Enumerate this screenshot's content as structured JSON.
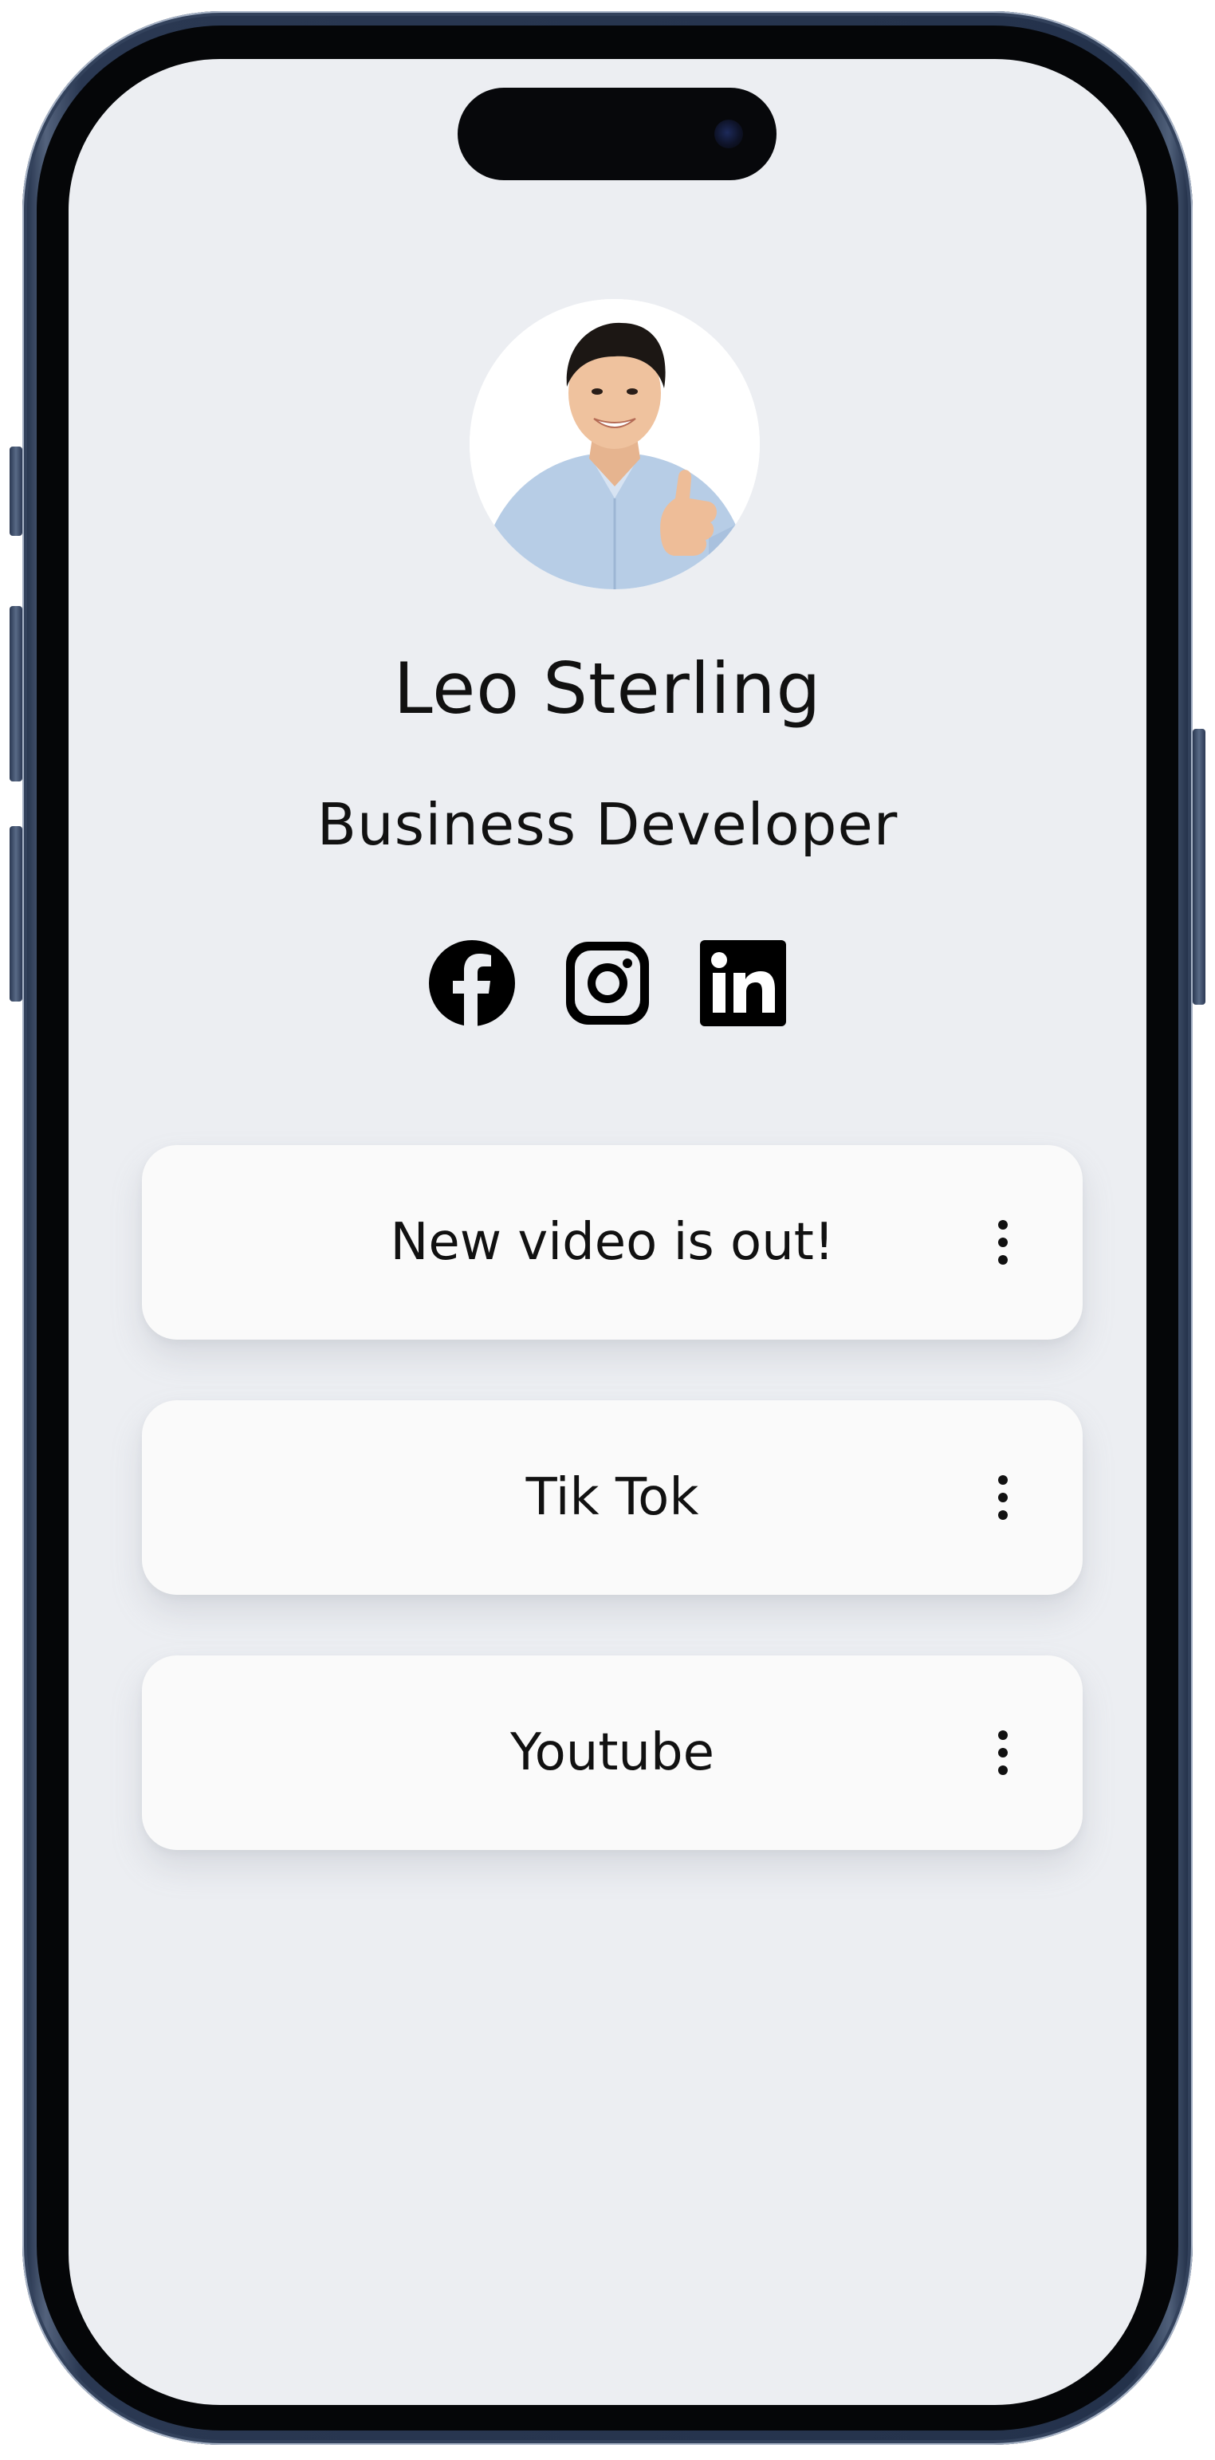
{
  "profile": {
    "name": "Leo Sterling",
    "role": "Business Developer",
    "avatar_icon": "person-photo"
  },
  "socials": [
    {
      "icon": "facebook-icon"
    },
    {
      "icon": "instagram-icon"
    },
    {
      "icon": "linkedin-icon"
    }
  ],
  "links": [
    {
      "label": "New video is out!",
      "menu_icon": "more-vertical-icon"
    },
    {
      "label": "Tik Tok",
      "menu_icon": "more-vertical-icon"
    },
    {
      "label": "Youtube",
      "menu_icon": "more-vertical-icon"
    }
  ],
  "colors": {
    "screen_background": "#eceef2",
    "card_background": "#fafafa",
    "text": "#111111",
    "phone_frame": "#24324b"
  }
}
